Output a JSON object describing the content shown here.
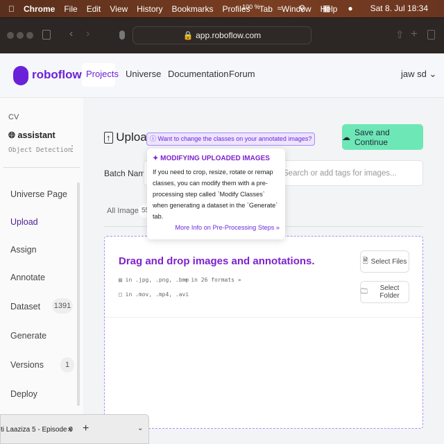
{
  "menubar": {
    "app": "Chrome",
    "items": [
      "File",
      "Edit",
      "View",
      "History",
      "Bookmarks",
      "Profiles",
      "Tab",
      "Window",
      "Help"
    ],
    "battery": "100 %",
    "datetime": "Sat 8. Jul 18:34"
  },
  "browser": {
    "url": "app.roboflow.com"
  },
  "nav": {
    "brand": "roboflow",
    "items": [
      "Projects",
      "Universe",
      "Documentation",
      "Forum"
    ],
    "active": "Projects",
    "user": "jaw sd",
    "brand_color": "#6b21d8"
  },
  "sidebar": {
    "workspace": "CV",
    "project": "assistant",
    "project_type": "Object Detection",
    "items": [
      {
        "label": "Universe Page"
      },
      {
        "label": "Upload",
        "active": true
      },
      {
        "label": "Assign"
      },
      {
        "label": "Annotate"
      },
      {
        "label": "Dataset",
        "badge": "1391"
      },
      {
        "label": "Generate"
      },
      {
        "label": "Versions",
        "badge": "1"
      },
      {
        "label": "Deploy"
      }
    ]
  },
  "main": {
    "title": "Upload",
    "hint": "Want to change the classes on your annotated images?",
    "save_label": "Save and Continue",
    "batch_label": "Batch Name:",
    "tags_placeholder": "Search or add tags for images...",
    "tab_all": "All Images",
    "tab_count": "55",
    "drop_title": "Drag and drop images and annotations.",
    "formats_images": "in .jpg, .png, .bmp",
    "formats_annotations": "in 26 formats",
    "formats_video": "in .mov, .mp4, .avi",
    "select_files": "Select Files",
    "select_folder": "Select Folder"
  },
  "popover": {
    "title": "MODIFYING UPLOADED IMAGES",
    "body": "If you need to crop, resize, rotate or remap classes, you can modify them with a pre-processing step called `Modify Classes` when generating a dataset in the `Generate` tab.",
    "link": "More Info on Pre-Processing Steps"
  },
  "tabbar": {
    "tab_title": "ti Laaziza 5 - Episode 9"
  }
}
